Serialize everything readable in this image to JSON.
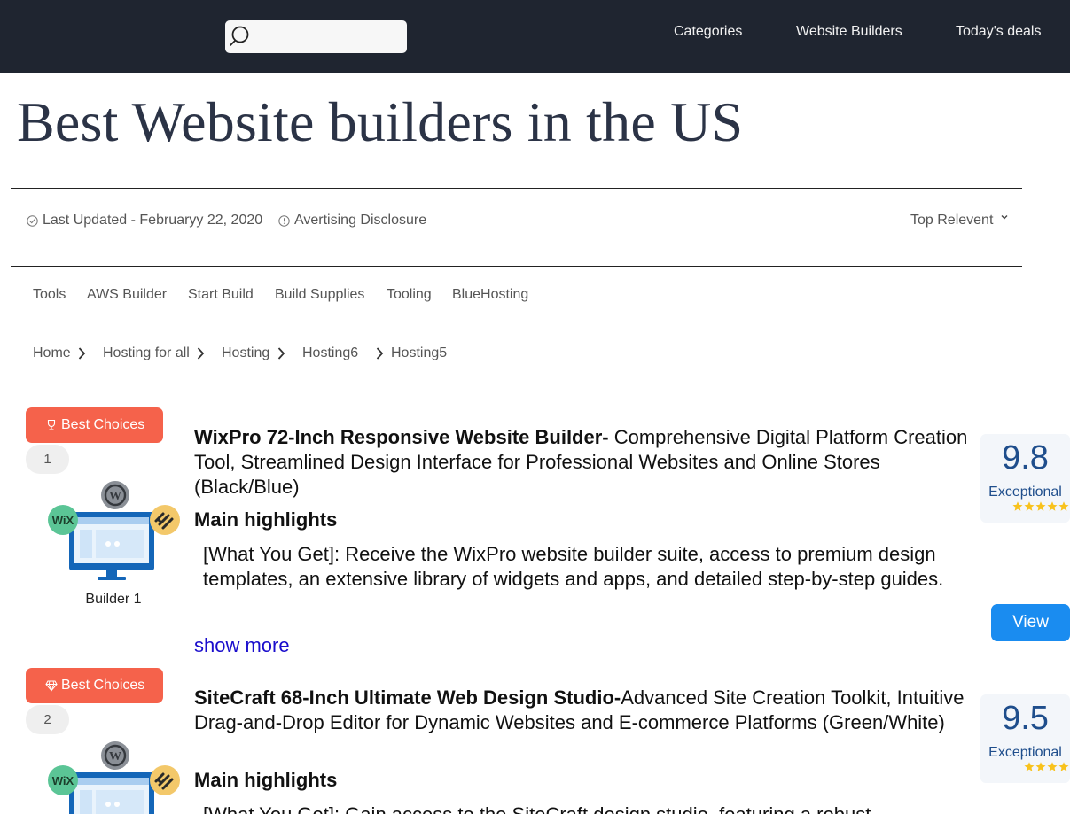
{
  "nav": {
    "search": {
      "value": "",
      "placeholder": ""
    },
    "links": [
      "Categories",
      "Website Builders",
      "Today's deals"
    ]
  },
  "page": {
    "title": "Best Website builders in the US"
  },
  "meta": {
    "updated": "Last Updated - Februaryy 22, 2020",
    "disclosure": "Avertising Disclosure",
    "sort": "Top Relevent"
  },
  "categories": [
    "Tools",
    "AWS Builder",
    "Start Build",
    "Build Supplies",
    "Tooling",
    "BlueHosting"
  ],
  "breadcrumb": [
    "Home",
    "Hosting for all",
    "Hosting",
    "Hosting6",
    "Hosting5"
  ],
  "products": [
    {
      "badge": "Best Choices",
      "badge_icon": "trophy-icon",
      "rank": "1",
      "image_caption": "Builder 1",
      "name_bold": "WixPro 72-Inch Responsive Website Builder-",
      "name_rest": " Comprehensive Digital Platform Creation Tool, Streamlined Design Interface for Professional Websites and Online Stores (Black/Blue)",
      "highlights_heading": "Main highlights",
      "highlight": "[What You Get]: Receive the WixPro website builder suite, access to premium design templates, an extensive library of widgets and apps, and detailed step-by-step guides.",
      "show_more": "show more",
      "score": "9.8",
      "score_label": "Exceptional",
      "stars": 5,
      "view_label": "View"
    },
    {
      "badge": "Best Choices",
      "badge_icon": "diamond-icon",
      "rank": "2",
      "image_caption": "",
      "name_bold": "SiteCraft 68-Inch Ultimate Web Design Studio-",
      "name_rest": "Advanced Site Creation Toolkit, Intuitive Drag-and-Drop Editor for Dynamic Websites and E-commerce Platforms (Green/White)",
      "highlights_heading": "Main highlights",
      "highlight": "[What You Get]: Gain access to the SiteCraft design studio, featuring a robust",
      "show_more": "",
      "score": "9.5",
      "score_label": "Exceptional",
      "stars": 4,
      "view_label": ""
    }
  ],
  "colors": {
    "navbar": "#1f2530",
    "badge": "#f5624b",
    "view_button": "#1a8cf0",
    "score_text": "#1f4e8c",
    "star": "#f8c21c",
    "link": "#1a0dcc"
  }
}
